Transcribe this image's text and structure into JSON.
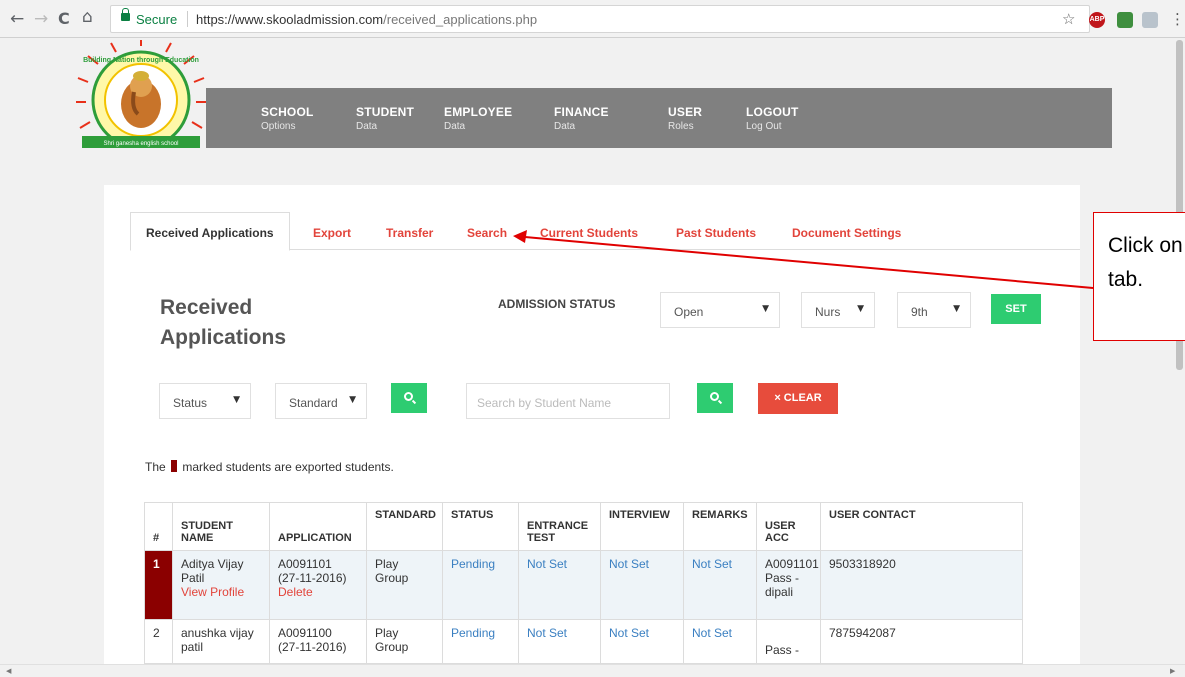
{
  "browser": {
    "secure_label": "Secure",
    "url_host": "https://www.skooladmission.com",
    "url_path": "/received_applications.php",
    "back_icon": "←",
    "forward_icon": "→",
    "reload_icon": "C",
    "home_icon": "⌂",
    "star_icon": "☆",
    "menu_icon": "⋮",
    "ext_abp": "ABP"
  },
  "nav": [
    {
      "main": "SCHOOL",
      "sub": "Options"
    },
    {
      "main": "STUDENT",
      "sub": "Data"
    },
    {
      "main": "EMPLOYEE",
      "sub": "Data"
    },
    {
      "main": "FINANCE",
      "sub": "Data"
    },
    {
      "main": "USER",
      "sub": "Roles"
    },
    {
      "main": "LOGOUT",
      "sub": "Log Out"
    }
  ],
  "tabs": [
    "Received Applications",
    "Export",
    "Transfer",
    "Search",
    "Current Students",
    "Past Students",
    "Document Settings"
  ],
  "page_title": "Received Applications",
  "admission": {
    "label": "ADMISSION STATUS",
    "status_value": "Open",
    "from_value": "Nurs",
    "to_value": "9th",
    "set_label": "SET"
  },
  "filters": {
    "status_value": "Status",
    "standard_value": "Standard",
    "search_placeholder": "Search by Student Name",
    "clear_label": "× CLEAR"
  },
  "note": {
    "before": "The",
    "after": "marked students are exported students."
  },
  "table": {
    "headers": [
      "#",
      "STUDENT NAME",
      "APPLICATION",
      "STANDARD",
      "STATUS",
      "ENTRANCE TEST",
      "INTERVIEW",
      "REMARKS",
      "USER ACC",
      "USER CONTACT"
    ],
    "rows": [
      {
        "num": "1",
        "name": "Aditya Vijay Patil",
        "name_link": "View Profile",
        "application": "A0091101",
        "app_date": "(27-11-2016)",
        "app_link": "Delete",
        "standard": "Play Group",
        "status": "Pending",
        "entrance": "Not Set",
        "interview": "Not Set",
        "remarks": "Not Set",
        "user_acc": "A0091101",
        "user_pass": "Pass - dipali",
        "contact": "9503318920"
      },
      {
        "num": "2",
        "name": "anushka vijay patil",
        "application": "A0091100",
        "app_date": "(27-11-2016)",
        "standard": "Play Group",
        "status": "Pending",
        "entrance": "Not Set",
        "interview": "Not Set",
        "remarks": "Not Set",
        "user_pass": "Pass -",
        "contact": "7875942087"
      }
    ]
  },
  "callout": {
    "line1": "Click on",
    "line2": "tab."
  },
  "logo": {
    "arc_text": "Building Nation through Education",
    "banner_text": "Shri ganesha english school"
  },
  "colors": {
    "accent_red": "#e2443b",
    "accent_green": "#2ecc71",
    "nav_gray": "#808080",
    "exported_mark": "#8b0000",
    "link_blue": "#3a7fc1"
  }
}
